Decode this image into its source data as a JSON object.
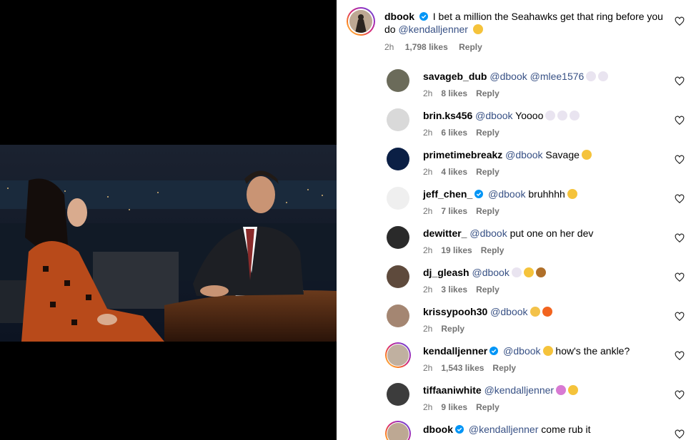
{
  "post_comment": {
    "username": "dbook",
    "text_1": "I bet a million the Seahawks get that ring before you",
    "text_2_prefix": "do",
    "mention": "@kendalljenner",
    "time": "2h",
    "likes": "1,798 likes",
    "reply": "Reply"
  },
  "replies": [
    {
      "username": "savageb_dub",
      "verified": false,
      "mentions": "@dbook @mlee1576",
      "text": "",
      "emojis": [
        "skull-emoji",
        "skull-emoji"
      ],
      "time": "2h",
      "likes": "8 likes",
      "reply": "Reply"
    },
    {
      "username": "brin.ks456",
      "verified": false,
      "mentions": "@dbook",
      "text": "Yoooo",
      "emojis": [
        "skull-emoji",
        "skull-emoji",
        "skull-emoji"
      ],
      "time": "2h",
      "likes": "6 likes",
      "reply": "Reply"
    },
    {
      "username": "primetimebreakz",
      "verified": false,
      "mentions": "@dbook",
      "text": "Savage",
      "emojis": [
        "laughing-emoji"
      ],
      "time": "2h",
      "likes": "4 likes",
      "reply": "Reply"
    },
    {
      "username": "jeff_chen_",
      "verified": true,
      "mentions": "@dbook",
      "text": "bruhhhh",
      "emojis": [
        "laughing-emoji"
      ],
      "time": "2h",
      "likes": "7 likes",
      "reply": "Reply"
    },
    {
      "username": "dewitter_",
      "verified": false,
      "mentions": "@dbook",
      "text": "put one on her dev",
      "emojis": [],
      "time": "2h",
      "likes": "19 likes",
      "reply": "Reply"
    },
    {
      "username": "dj_gleash",
      "verified": false,
      "mentions": "@dbook",
      "text": "",
      "emojis": [
        "skull-emoji",
        "laughing-emoji",
        "goat-emoji"
      ],
      "time": "2h",
      "likes": "3 likes",
      "reply": "Reply"
    },
    {
      "username": "krissypooh30",
      "verified": false,
      "mentions": "@dbook",
      "text": "",
      "emojis": [
        "clap-emoji",
        "fire-emoji"
      ],
      "time": "2h",
      "likes": "",
      "reply": "Reply"
    },
    {
      "username": "kendalljenner",
      "verified": true,
      "mentions": "@dbook",
      "text": "how's the ankle?",
      "emojis": [
        "eye-roll-emoji"
      ],
      "time": "2h",
      "likes": "1,543 likes",
      "reply": "Reply"
    },
    {
      "username": "tiffaaniwhite",
      "verified": false,
      "mentions": "@kendalljenner",
      "text": "",
      "emojis": [
        "scream-emoji",
        "laughing-emoji"
      ],
      "time": "2h",
      "likes": "9 likes",
      "reply": "Reply"
    },
    {
      "username": "dbook",
      "verified": true,
      "mentions": "@kendalljenner",
      "text": "come rub it",
      "emojis": [],
      "time": "",
      "likes": "",
      "reply": ""
    }
  ],
  "colors": {
    "mention": "#385185",
    "meta": "#737373",
    "verified": "#0095f6"
  }
}
